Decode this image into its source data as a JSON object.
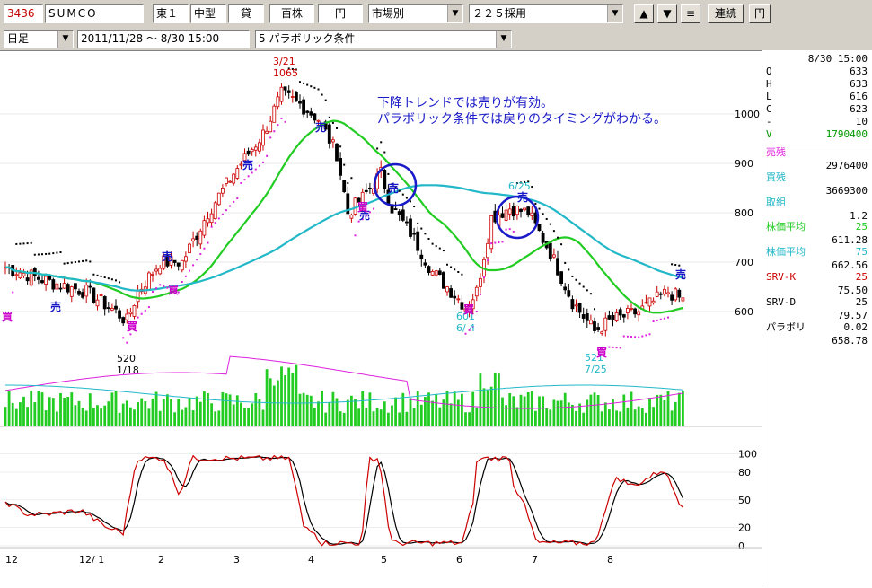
{
  "toolbar": {
    "code": "3436",
    "name": "SUMCO",
    "market": "東１",
    "size": "中型",
    "credit": "貸",
    "unit": "百株",
    "currency": "円",
    "market_sel": "市場別",
    "index_sel": "２２５採用",
    "up": "▲",
    "down": "▼",
    "menu": "≡",
    "link": "連続",
    "yen": "円"
  },
  "toolbar2": {
    "period": "日足",
    "range": "2011/11/28 〜 8/30 15:00",
    "condition": "5 パラボリック条件"
  },
  "annotation": {
    "line1": "下降トレンドでは売りが有効。",
    "line2": "パラボリック条件では戻りのタイミングがわかる。"
  },
  "side": {
    "time": "8/30 15:00",
    "ohlc": [
      {
        "k": "O",
        "v": "633"
      },
      {
        "k": "H",
        "v": "633"
      },
      {
        "k": "L",
        "v": "616"
      },
      {
        "k": "C",
        "v": "623"
      },
      {
        "k": "-",
        "v": "10"
      },
      {
        "k": "V",
        "v": "1790400"
      }
    ],
    "uri_label": "売残",
    "uri_value": "2976400",
    "kai_label": "買残",
    "kai_value": "3669300",
    "tori_label": "取組",
    "tori_value": "1.2",
    "ma25_label": "株価平均",
    "ma25_n": "25",
    "ma25_value": "611.28",
    "ma75_label": "株価平均",
    "ma75_n": "75",
    "ma75_value": "662.56",
    "srvk_label": "SRV-K",
    "srvk_n": "25",
    "srvk_value": "75.50",
    "srvd_label": "SRV-D",
    "srvd_n": "25",
    "srvd_value": "79.57",
    "para_label": "パラボリ",
    "para_n": "0.02",
    "para_value": "658.78"
  },
  "chart_data": {
    "type": "candlestick",
    "price_ticks": [
      "1000",
      "900",
      "800",
      "700",
      "600"
    ],
    "osc_ticks": [
      "100",
      "80",
      "50",
      "20",
      "0"
    ],
    "x_labels": [
      "12",
      "12/ 1",
      "2",
      "3",
      "4",
      "5",
      "6",
      "7",
      "8"
    ],
    "annotations": [
      {
        "text": "3/21",
        "value": "1065"
      },
      {
        "text": "520",
        "value": "1/18"
      },
      {
        "text": "601",
        "value": "6/ 4"
      },
      {
        "text": "6/25",
        "value": ""
      },
      {
        "text": "521",
        "value": "7/25"
      }
    ],
    "signals": [
      {
        "type": "買"
      },
      {
        "type": "売"
      },
      {
        "type": "売"
      },
      {
        "type": "買"
      },
      {
        "type": "買"
      },
      {
        "type": "売"
      },
      {
        "type": "売"
      },
      {
        "type": "売"
      },
      {
        "type": "買"
      },
      {
        "type": "売"
      },
      {
        "type": "買"
      },
      {
        "type": "売"
      },
      {
        "type": "買"
      },
      {
        "type": "売"
      }
    ],
    "colors": {
      "ma25": "#22cc22",
      "ma75": "#22b8c8",
      "sar": "#dd22dd",
      "srvk": "#cc0000",
      "srvd": "#000000",
      "volume": "#22cc22"
    }
  }
}
